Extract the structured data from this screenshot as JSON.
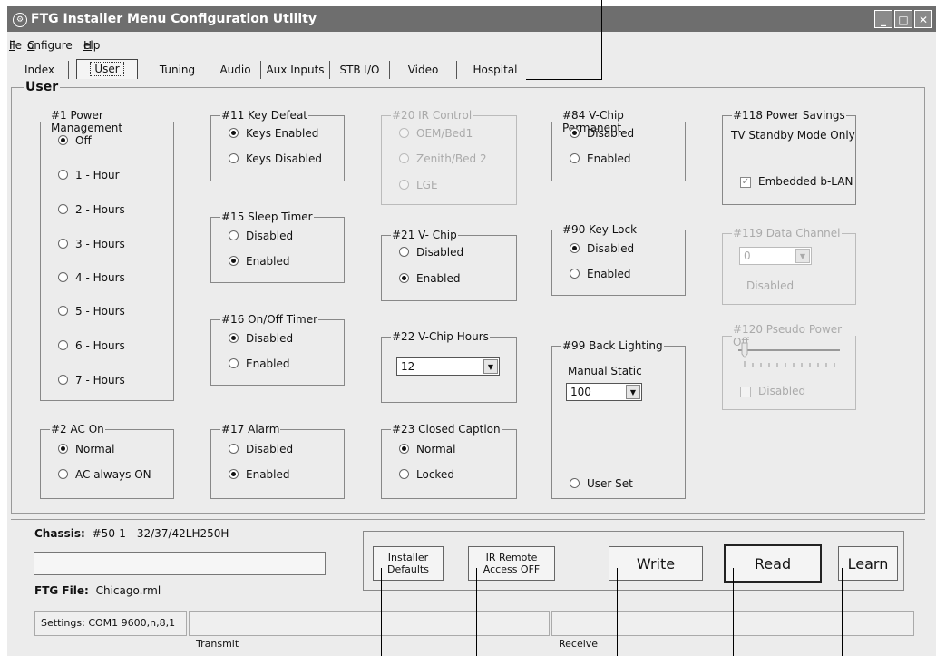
{
  "window": {
    "title": "FTG Installer Menu Configuration Utility",
    "icon": "ftg-app-icon",
    "controls": [
      "_",
      "□",
      "X"
    ]
  },
  "menu": {
    "file": "File",
    "configure": "Configure",
    "help": "Help"
  },
  "tabs": [
    "Index",
    "User",
    "Tuning",
    "Audio",
    "Aux Inputs",
    "STB I/O",
    "Video",
    "Hospital"
  ],
  "active_tab": "User",
  "panel_title": "User",
  "groups": {
    "power_mgmt": {
      "title": "#1 Power Management",
      "options": [
        "Off",
        "1 - Hour",
        "2 - Hours",
        "3 - Hours",
        "4 - Hours",
        "5 - Hours",
        "6 - Hours",
        "7 - Hours"
      ],
      "selected": "Off"
    },
    "ac_on": {
      "title": "#2 AC On",
      "options": [
        "Normal",
        "AC always ON"
      ],
      "selected": "Normal"
    },
    "key_defeat": {
      "title": "#11 Key Defeat",
      "options": [
        "Keys Enabled",
        "Keys Disabled"
      ],
      "selected": "Keys Enabled"
    },
    "sleep_timer": {
      "title": "#15 Sleep Timer",
      "options": [
        "Disabled",
        "Enabled"
      ],
      "selected": "Enabled"
    },
    "onoff_timer": {
      "title": "#16 On/Off Timer",
      "options": [
        "Disabled",
        "Enabled"
      ],
      "selected": "Disabled"
    },
    "alarm": {
      "title": "#17 Alarm",
      "options": [
        "Disabled",
        "Enabled"
      ],
      "selected": "Enabled"
    },
    "ir_control": {
      "title": "#20 IR Control",
      "options": [
        "OEM/Bed1",
        "Zenith/Bed 2",
        "LGE"
      ],
      "selected": ""
    },
    "vchip": {
      "title": "#21 V- Chip",
      "options": [
        "Disabled",
        "Enabled"
      ],
      "selected": "Enabled"
    },
    "vchip_hours": {
      "title": "#22 V-Chip Hours",
      "value": "12"
    },
    "closed_caption": {
      "title": "#23 Closed Caption",
      "options": [
        "Normal",
        "Locked"
      ],
      "selected": "Normal"
    },
    "vchip_perm": {
      "title": "#84 V-Chip Permanent",
      "options": [
        "Disabled",
        "Enabled"
      ],
      "selected": "Disabled"
    },
    "key_lock": {
      "title": "#90 Key Lock",
      "options": [
        "Disabled",
        "Enabled"
      ],
      "selected": "Disabled"
    },
    "back_light": {
      "title": "#99 Back Lighting",
      "label": "Manual Static",
      "value": "100",
      "user_set": "User Set"
    },
    "power_savings": {
      "title": "#118 Power Savings",
      "label": "TV Standby Mode Only",
      "checkbox": "Embedded b-LAN"
    },
    "data_channel": {
      "title": "#119 Data Channel",
      "value": "0",
      "label": "Disabled"
    },
    "pseudo_power": {
      "title": "#120 Pseudo Power Off",
      "checkbox": "Disabled"
    }
  },
  "chassis": {
    "label": "Chassis:",
    "value": "#50-1 - 32/37/42LH250H"
  },
  "ftg_file": {
    "label": "FTG File:",
    "value": "Chicago.rml"
  },
  "buttons": {
    "installer_defaults": [
      "Installer",
      "Defaults"
    ],
    "ir_remote": [
      "IR Remote",
      "Access OFF"
    ],
    "write": "Write",
    "read": "Read",
    "learn": "Learn"
  },
  "statusbar": {
    "settings": "Settings: COM1 9600,n,8,1",
    "transmit": "Transmit",
    "receive": "Receive"
  }
}
